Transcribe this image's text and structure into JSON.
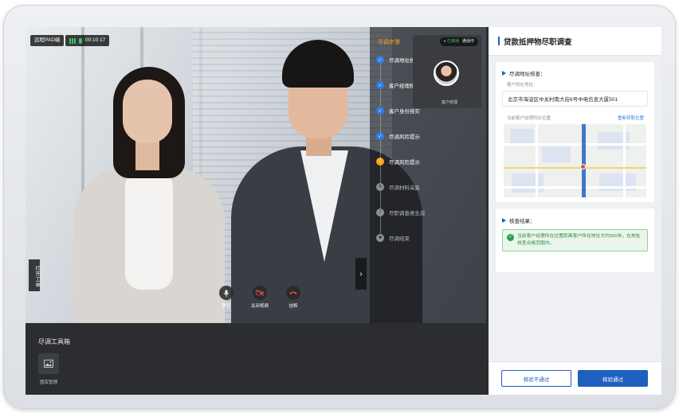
{
  "video": {
    "badge_device": "远程PAD端",
    "timer": "00:10:17",
    "side_tab": "打开工单",
    "controls": {
      "mute": "静音",
      "camera_off": "关闭视频",
      "hangup": "挂断"
    }
  },
  "steps": {
    "title": "尽调步骤",
    "items": [
      {
        "label": "尽调地址核查",
        "status": "done",
        "num": "✓"
      },
      {
        "label": "客户经理核身",
        "status": "done",
        "num": "✓"
      },
      {
        "label": "客户身份核实",
        "status": "done",
        "num": "✓"
      },
      {
        "label": "尽调风险提示",
        "status": "done",
        "num": "✓"
      },
      {
        "label": "尽调风险提示",
        "status": "active",
        "num": "!"
      },
      {
        "label": "尽调材料采集",
        "status": "todo",
        "num": "6"
      },
      {
        "label": "尽职调查表生成",
        "status": "todo",
        "num": "7"
      },
      {
        "label": "尽调结束",
        "status": "todo",
        "num": "■"
      }
    ]
  },
  "pip": {
    "status_a": "● 已接通",
    "status_b": "通话中",
    "caption": "客户经理"
  },
  "toolbox": {
    "title": "尽调工具箱",
    "tools": [
      {
        "label": "图库管理"
      }
    ]
  },
  "panel": {
    "title": "贷款抵押物尽职调查",
    "address_section": {
      "title": "尽调地址核查：",
      "field_label": "客户所在地址：",
      "address_value": "北京市海淀区中关村南大街6号中电信息大厦501",
      "location_label": "当前客户经理所在位置",
      "refresh_link": "重新获取位置"
    },
    "result_section": {
      "title": "核查结果：",
      "message": "当前客户经理所在位置距离客户所在地址大约500米，在地址核查合格范围内。"
    },
    "buttons": {
      "reject": "核验不通过",
      "pass": "核验通过"
    }
  },
  "colors": {
    "accent": "#1f5fbf",
    "step_done": "#2f7ee6",
    "step_active": "#f5a623",
    "success": "#2e9e4f"
  }
}
